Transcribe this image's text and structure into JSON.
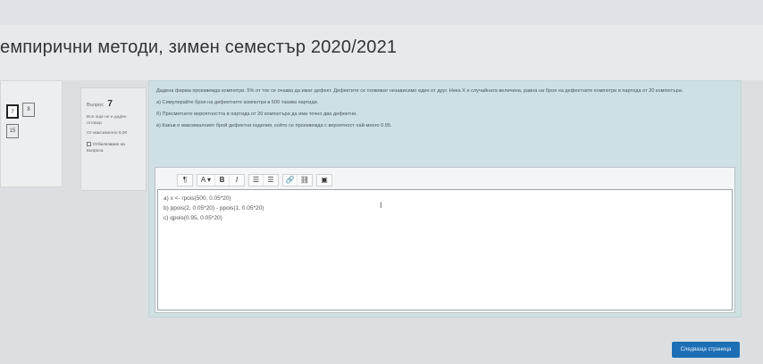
{
  "page": {
    "title": "емпирични методи, зимен семестър 2020/2021"
  },
  "quiz_nav": {
    "buttons": [
      {
        "label": "7",
        "state": "current"
      },
      {
        "label": "8",
        "state": "answered"
      },
      {
        "label": "15",
        "state": "answered"
      }
    ]
  },
  "question_info": {
    "number_label": "Въпрос",
    "number": "7",
    "status": "Все още не е даден отговор",
    "marks": "От максимално 6,00",
    "flag_label": "Отбелязване на въпроса"
  },
  "question": {
    "text": [
      "Дадена фирма произвежда компютри. 5% от тях се очаква да имат дефект. Дефектите се появяват независимо един от друг. Нека X е случайната величина, равна на броя на дефектните компютри в партида от 20 компютъра.",
      "а) Симулирайте броя на дефектните компютри в 500 такива партиди.",
      "б) Пресметнете вероятността в партида от 20 компютъра да има точно два дефектни.",
      "в) Какъв е максималният брой дефектни изделия, който се произвежда с вероятност най-много 0.95."
    ]
  },
  "editor": {
    "toolbar": {
      "paragraph": "¶",
      "font": "A ▾",
      "bold": "B",
      "italic": "I",
      "ul": "☰",
      "ol": "☰",
      "link": "🔗",
      "unlink": "⛓",
      "image": "▣"
    },
    "answer_lines": [
      "a) x <- rpois(500, 0.05*20)",
      "b) ppois(2, 0.05*20) - ppois(1, 0.05*20)",
      "c) qpois(0.95, 0.05*20)"
    ],
    "caret": "I"
  },
  "footer": {
    "next_label": "Следваща страница"
  }
}
